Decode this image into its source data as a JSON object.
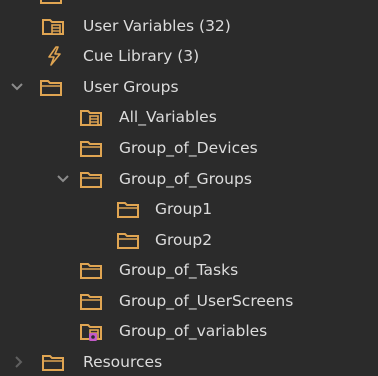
{
  "colors": {
    "background": "#2b2b2b",
    "text": "#dcdcdc",
    "folder": "#e0a552",
    "arrow": "#8c8c8c",
    "badge": "#c45bc9"
  },
  "tree": {
    "items": [
      {
        "label": "User Variables (32)",
        "icon": "variables-folder-icon"
      },
      {
        "label": "Cue Library (3)",
        "icon": "lightning-icon"
      },
      {
        "label": "User Groups",
        "icon": "folder-icon",
        "expanded": true
      },
      {
        "label": "All_Variables",
        "icon": "variables-folder-icon"
      },
      {
        "label": "Group_of_Devices",
        "icon": "folder-icon"
      },
      {
        "label": "Group_of_Groups",
        "icon": "folder-icon",
        "expanded": true
      },
      {
        "label": "Group1",
        "icon": "folder-icon"
      },
      {
        "label": "Group2",
        "icon": "folder-icon"
      },
      {
        "label": "Group_of_Tasks",
        "icon": "folder-icon"
      },
      {
        "label": "Group_of_UserScreens",
        "icon": "folder-icon"
      },
      {
        "label": "Group_of_variables",
        "icon": "variables-folder-badge-icon"
      },
      {
        "label": "Resources",
        "icon": "folder-icon",
        "expanded": false
      }
    ]
  }
}
